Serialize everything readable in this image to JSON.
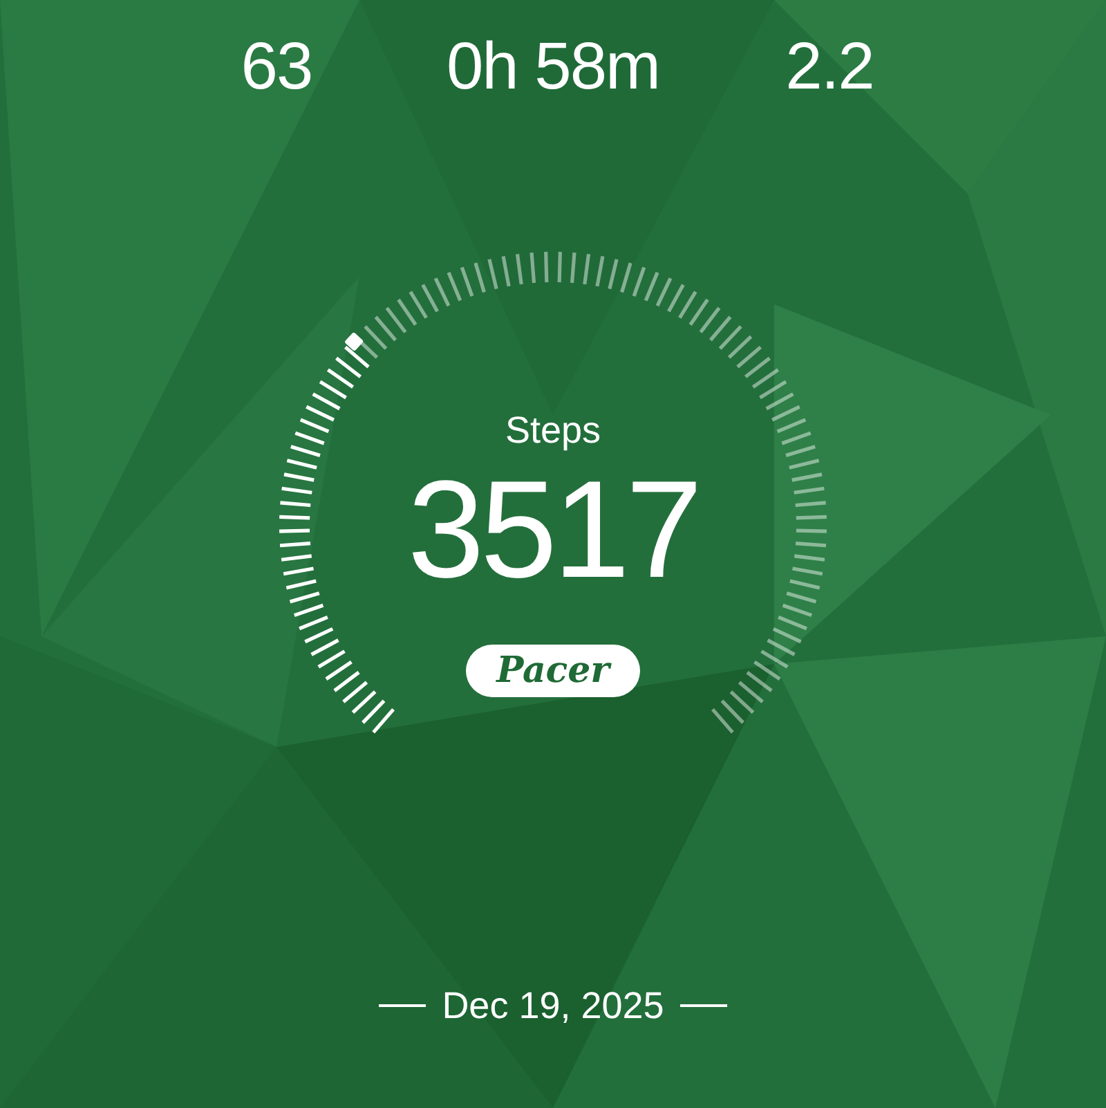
{
  "stats": [
    {
      "value": "63"
    },
    {
      "value": "0h 58m"
    },
    {
      "value": "2.2"
    }
  ],
  "gauge": {
    "label": "Steps",
    "value": "3517"
  },
  "badge": {
    "text": "Pacer"
  },
  "date": "Dec 19, 2025"
}
